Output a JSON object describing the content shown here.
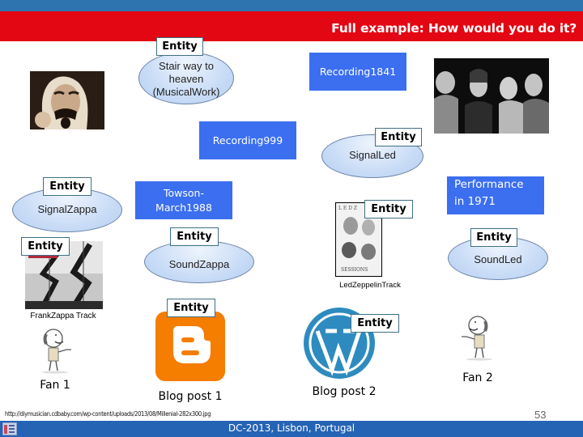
{
  "slide": {
    "title": "Full example: How would you do it?",
    "footer": "DC-2013, Lisbon, Portugal",
    "page_number": "53",
    "image_credit_url": "http://diymusician.cdbaby.com/wp-content/uploads/2013/08/Millenial-282x300.jpg"
  },
  "entity_tag_label": "Entity",
  "nodes": {
    "musical_work": {
      "label_line1": "Stair way to",
      "label_line2": "heaven",
      "label_line3": "(MusicalWork)"
    },
    "recording_1841": {
      "label": "Recording1841"
    },
    "recording_999": {
      "label": "Recording999"
    },
    "signal_led": {
      "label": "SignalLed"
    },
    "signal_zappa": {
      "label": "SignalZappa"
    },
    "towson": {
      "label_line1": "Towson-",
      "label_line2": "March1988"
    },
    "performance_1971": {
      "label_line1": "Performance",
      "label_line2": "in 1971"
    },
    "sound_zappa": {
      "label": "SoundZappa"
    },
    "sound_led": {
      "label": "SoundLed"
    },
    "led_zeppelin_track": {
      "caption": "LedZeppelinTrack"
    },
    "frank_zappa_track": {
      "caption": "FrankZappa Track"
    },
    "fan_1": {
      "caption": "Fan 1"
    },
    "fan_2": {
      "caption": "Fan 2"
    },
    "blog_post_1": {
      "caption": "Blog post 1"
    },
    "blog_post_2": {
      "caption": "Blog post 2"
    }
  },
  "colors": {
    "title_bar": "#e30613",
    "top_band": "#2e75b0",
    "footer_bar": "#2563b5",
    "blue_box": "#3b6ff0",
    "ellipse_fill": "#c9dcf6",
    "blogger_orange": "#f57d00",
    "wordpress_blue": "#2e8bbf"
  }
}
